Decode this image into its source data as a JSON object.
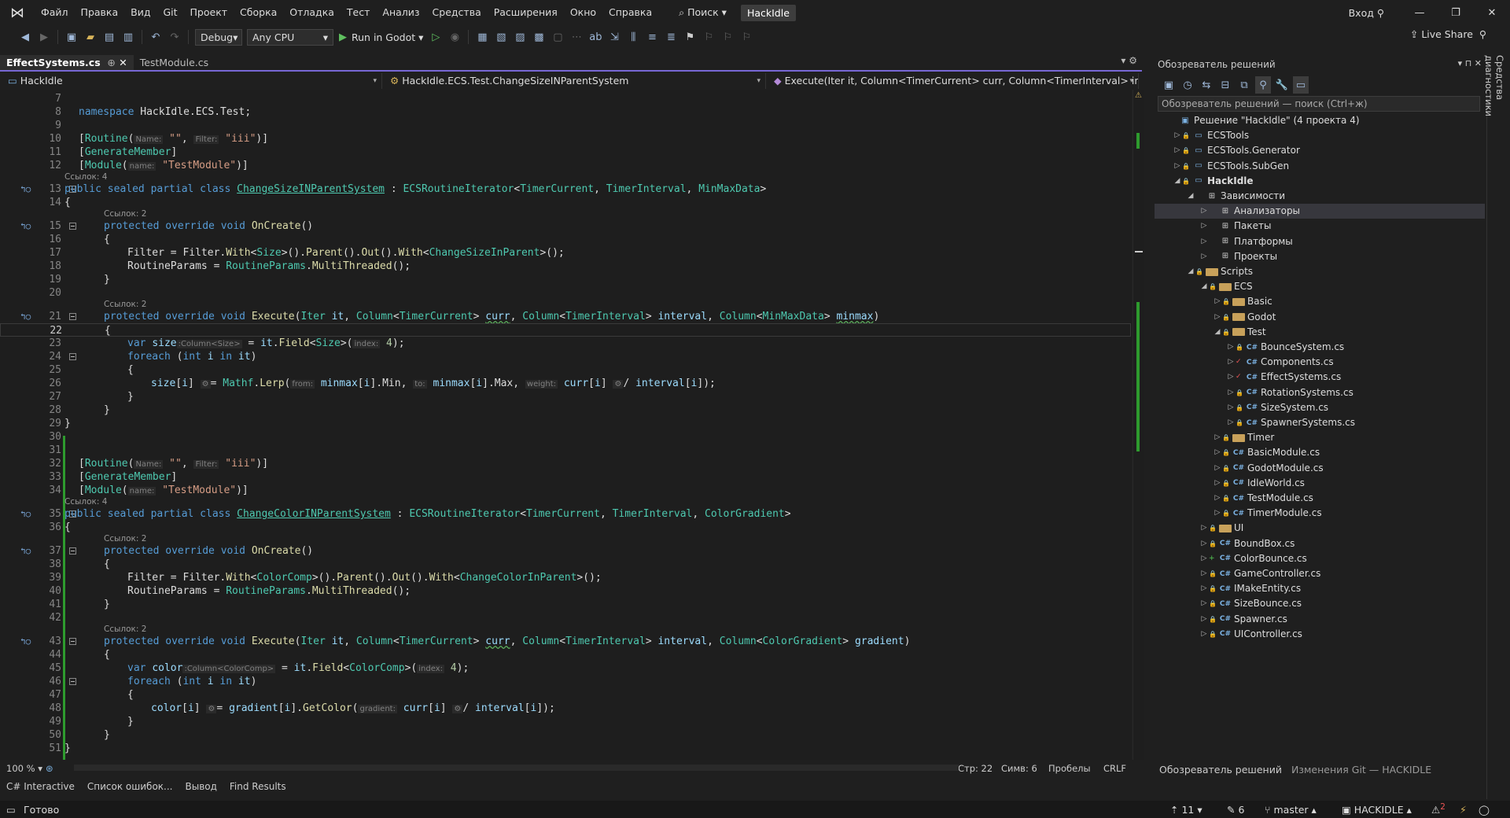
{
  "menu": [
    "Файл",
    "Правка",
    "Вид",
    "Git",
    "Проект",
    "Сборка",
    "Отладка",
    "Тест",
    "Анализ",
    "Средства",
    "Расширения",
    "Окно",
    "Справка"
  ],
  "search": "Поиск",
  "solution_title": "HackIdle",
  "signin": "Вход",
  "toolbar": {
    "config": "Debug",
    "platform": "Any CPU",
    "run": "Run in Godot",
    "liveshare": "Live Share"
  },
  "tabs": [
    {
      "label": "EffectSystems.cs",
      "active": true
    },
    {
      "label": "TestModule.cs",
      "active": false
    }
  ],
  "nav": {
    "project": "HackIdle",
    "type": "HackIdle.ECS.Test.ChangeSizeINParentSystem",
    "member": "Execute(Iter it, Column<TimerCurrent> curr, Column<TimerInterval> interval, Colu"
  },
  "lines": [
    {
      "n": "7",
      "html": ""
    },
    {
      "n": "8",
      "html": "<span class='k'>namespace</span> HackIdle.ECS.Test;"
    },
    {
      "n": "9",
      "html": ""
    },
    {
      "n": "10",
      "html": "[<span class='t'>Routine</span>(<span class='h'>Name:</span> <span class='s'>\"\"</span>, <span class='h'>Filter:</span> <span class='s'>\"iii\"</span>)]"
    },
    {
      "n": "11",
      "html": "[<span class='t'>GenerateMember</span>]"
    },
    {
      "n": "12",
      "html": "[<span class='t'>Module</span>(<span class='h'>name:</span> <span class='s'>\"TestModule\"</span>)]"
    },
    {
      "n": "13",
      "lens": "Ссылок: 4",
      "html": "<span class='k'>public sealed partial class</span> <span class='t u'>ChangeSizeINParentSystem</span> : <span class='t'>ECSRoutineIterator</span>&lt;<span class='t'>TimerCurrent</span>, <span class='t'>TimerInterval</span>, <span class='t'>MinMaxData</span>&gt;",
      "fold": true,
      "mark": true,
      "indent": -18
    },
    {
      "n": "14",
      "html": "{",
      "indent": -18
    },
    {
      "n": "15",
      "lens": "Ссылок: 2",
      "html": "<span class='k'>protected override void</span> <span class='m'>OnCreate</span>()",
      "fold": true,
      "mark": true,
      "indent": 8
    },
    {
      "n": "16",
      "html": "{",
      "indent": 8
    },
    {
      "n": "17",
      "html": "Filter = Filter.<span class='m'>With</span>&lt;<span class='t'>Size</span>&gt;().<span class='m'>Parent</span>().<span class='m'>Out</span>().<span class='m'>With</span>&lt;<span class='t'>ChangeSizeInParent</span>&gt;();",
      "indent": 38
    },
    {
      "n": "18",
      "html": "RoutineParams = <span class='t'>RoutineParams</span>.<span class='m'>MultiThreaded</span>();",
      "indent": 38
    },
    {
      "n": "19",
      "html": "}",
      "indent": 8
    },
    {
      "n": "20",
      "html": ""
    },
    {
      "n": "21",
      "lens": "Ссылок: 2",
      "html": "<span class='k'>protected override void</span> <span class='m'>Execute</span>(<span class='t'>Iter</span> <span class='v'>it</span>, <span class='t'>Column</span>&lt;<span class='t'>TimerCurrent</span>&gt; <span class='v w'>curr</span>, <span class='t'>Column</span>&lt;<span class='t'>TimerInterval</span>&gt; <span class='v'>interval</span>, <span class='t'>Column</span>&lt;<span class='t'>MinMaxData</span>&gt; <span class='v w'>minmax</span>)",
      "fold": true,
      "mark": true,
      "indent": 8
    },
    {
      "n": "22",
      "html": "{",
      "indent": 8,
      "cur": true
    },
    {
      "n": "23",
      "html": "<span class='k'>var</span> <span class='v'>size</span><span class='h'>:Column&lt;Size&gt;</span> = <span class='v'>it</span>.<span class='m'>Field</span>&lt;<span class='t'>Size</span>&gt;(<span class='h'>index:</span> <span class='n'>4</span>);",
      "indent": 38
    },
    {
      "n": "24",
      "html": "<span class='k'>foreach</span> (<span class='k'>int</span> <span class='v'>i</span> <span class='k'>in</span> <span class='v'>it</span>)",
      "fold": true,
      "indent": 38
    },
    {
      "n": "25",
      "html": "{",
      "indent": 38
    },
    {
      "n": "26",
      "html": "<span class='v'>size</span>[<span class='v'>i</span>] <span class='h'>⚙</span>= <span class='t'>Mathf</span>.<span class='m'>Lerp</span>(<span class='h'>from:</span> <span class='v'>minmax</span>[<span class='v'>i</span>].Min, <span class='h'>to:</span> <span class='v'>minmax</span>[<span class='v'>i</span>].Max, <span class='h'>weight:</span> <span class='v'>curr</span>[<span class='v'>i</span>] <span class='h'>⚙</span>/ <span class='v'>interval</span>[<span class='v'>i</span>]);",
      "indent": 68
    },
    {
      "n": "27",
      "html": "}",
      "indent": 38
    },
    {
      "n": "28",
      "html": "}",
      "indent": 8
    },
    {
      "n": "29",
      "html": "}",
      "indent": -18
    },
    {
      "n": "30",
      "html": ""
    },
    {
      "n": "31",
      "html": ""
    },
    {
      "n": "32",
      "html": "[<span class='t'>Routine</span>(<span class='h'>Name:</span> <span class='s'>\"\"</span>, <span class='h'>Filter:</span> <span class='s'>\"iii\"</span>)]"
    },
    {
      "n": "33",
      "html": "[<span class='t'>GenerateMember</span>]"
    },
    {
      "n": "34",
      "html": "[<span class='t'>Module</span>(<span class='h'>name:</span> <span class='s'>\"TestModule\"</span>)]"
    },
    {
      "n": "35",
      "lens": "Ссылок: 4",
      "html": "<span class='k'>public sealed partial class</span> <span class='t u'>ChangeColorINParentSystem</span> : <span class='t'>ECSRoutineIterator</span>&lt;<span class='t'>TimerCurrent</span>, <span class='t'>TimerInterval</span>, <span class='t'>ColorGradient</span>&gt;",
      "fold": true,
      "mark": true,
      "indent": -18
    },
    {
      "n": "36",
      "html": "{",
      "indent": -18
    },
    {
      "n": "37",
      "lens": "Ссылок: 2",
      "html": "<span class='k'>protected override void</span> <span class='m'>OnCreate</span>()",
      "fold": true,
      "mark": true,
      "indent": 8
    },
    {
      "n": "38",
      "html": "{",
      "indent": 8
    },
    {
      "n": "39",
      "html": "Filter = Filter.<span class='m'>With</span>&lt;<span class='t'>ColorComp</span>&gt;().<span class='m'>Parent</span>().<span class='m'>Out</span>().<span class='m'>With</span>&lt;<span class='t'>ChangeColorInParent</span>&gt;();",
      "indent": 38
    },
    {
      "n": "40",
      "html": "RoutineParams = <span class='t'>RoutineParams</span>.<span class='m'>MultiThreaded</span>();",
      "indent": 38
    },
    {
      "n": "41",
      "html": "}",
      "indent": 8
    },
    {
      "n": "42",
      "html": ""
    },
    {
      "n": "43",
      "lens": "Ссылок: 2",
      "html": "<span class='k'>protected override void</span> <span class='m'>Execute</span>(<span class='t'>Iter</span> <span class='v'>it</span>, <span class='t'>Column</span>&lt;<span class='t'>TimerCurrent</span>&gt; <span class='v w'>curr</span>, <span class='t'>Column</span>&lt;<span class='t'>TimerInterval</span>&gt; <span class='v'>interval</span>, <span class='t'>Column</span>&lt;<span class='t'>ColorGradient</span>&gt; <span class='v'>gradient</span>)",
      "fold": true,
      "mark": true,
      "indent": 8
    },
    {
      "n": "44",
      "html": "{",
      "indent": 8
    },
    {
      "n": "45",
      "html": "<span class='k'>var</span> <span class='v'>color</span><span class='h'>:Column&lt;ColorComp&gt;</span> = <span class='v'>it</span>.<span class='m'>Field</span>&lt;<span class='t'>ColorComp</span>&gt;(<span class='h'>index:</span> <span class='n'>4</span>);",
      "indent": 38
    },
    {
      "n": "46",
      "html": "<span class='k'>foreach</span> (<span class='k'>int</span> <span class='v'>i</span> <span class='k'>in</span> <span class='v'>it</span>)",
      "fold": true,
      "indent": 38
    },
    {
      "n": "47",
      "html": "{",
      "indent": 38
    },
    {
      "n": "48",
      "html": "<span class='v'>color</span>[<span class='v'>i</span>] <span class='h'>⚙</span>= <span class='v'>gradient</span>[<span class='v'>i</span>].<span class='m'>GetColor</span>(<span class='h'>gradient:</span> <span class='v'>curr</span>[<span class='v'>i</span>] <span class='h'>⚙</span>/ <span class='v'>interval</span>[<span class='v'>i</span>]);",
      "indent": 68
    },
    {
      "n": "49",
      "html": "}",
      "indent": 38
    },
    {
      "n": "50",
      "html": "}",
      "indent": 8
    },
    {
      "n": "51",
      "html": "}",
      "indent": -18
    }
  ],
  "editor_status": {
    "zoom": "100 %",
    "line": "Стр: 22",
    "col": "Симв: 6",
    "spaces": "Пробелы",
    "eol": "CRLF"
  },
  "bottom_tabs": [
    "C# Interactive",
    "Список ошибок...",
    "Вывод",
    "Find Results"
  ],
  "status": {
    "ready": "Готово",
    "up": "11",
    "pencil": "6",
    "branch": "master",
    "repo": "HACKIDLE",
    "errors": "2"
  },
  "solution_explorer": {
    "title": "Обозреватель решений",
    "search_placeholder": "Обозреватель решений — поиск (Ctrl+ж)",
    "vertical_tab": "Средства диагностики",
    "footer": [
      "Обозреватель решений",
      "Изменения Git — HACKIDLE"
    ],
    "items": [
      {
        "label": "Решение \"HackIdle\"  (4 проекта 4)",
        "level": 0,
        "arrow": "",
        "icon": "solution"
      },
      {
        "label": "ECSTools",
        "level": 1,
        "arrow": "▷",
        "icon": "project"
      },
      {
        "label": "ECSTools.Generator",
        "level": 1,
        "arrow": "▷",
        "icon": "project"
      },
      {
        "label": "ECSTools.SubGen",
        "level": 1,
        "arrow": "▷",
        "icon": "project"
      },
      {
        "label": "HackIdle",
        "level": 1,
        "arrow": "◢",
        "icon": "project",
        "bold": true
      },
      {
        "label": "Зависимости",
        "level": 2,
        "arrow": "◢",
        "icon": "deps"
      },
      {
        "label": "Анализаторы",
        "level": 3,
        "arrow": "▷",
        "icon": "analyzer",
        "selected": true
      },
      {
        "label": "Пакеты",
        "level": 3,
        "arrow": "▷",
        "icon": "packages"
      },
      {
        "label": "Платформы",
        "level": 3,
        "arrow": "▷",
        "icon": "platform"
      },
      {
        "label": "Проекты",
        "level": 3,
        "arrow": "▷",
        "icon": "projects"
      },
      {
        "label": "Scripts",
        "level": 2,
        "arrow": "◢",
        "icon": "folder"
      },
      {
        "label": "ECS",
        "level": 3,
        "arrow": "◢",
        "icon": "folder"
      },
      {
        "label": "Basic",
        "level": 4,
        "arrow": "▷",
        "icon": "folder"
      },
      {
        "label": "Godot",
        "level": 4,
        "arrow": "▷",
        "icon": "folder"
      },
      {
        "label": "Test",
        "level": 4,
        "arrow": "◢",
        "icon": "folder"
      },
      {
        "label": "BounceSystem.cs",
        "level": 5,
        "arrow": "▷",
        "icon": "cs"
      },
      {
        "label": "Components.cs",
        "level": 5,
        "arrow": "▷",
        "icon": "cs",
        "check": true
      },
      {
        "label": "EffectSystems.cs",
        "level": 5,
        "arrow": "▷",
        "icon": "cs",
        "check": true
      },
      {
        "label": "RotationSystems.cs",
        "level": 5,
        "arrow": "▷",
        "icon": "cs"
      },
      {
        "label": "SizeSystem.cs",
        "level": 5,
        "arrow": "▷",
        "icon": "cs"
      },
      {
        "label": "SpawnerSystems.cs",
        "level": 5,
        "arrow": "▷",
        "icon": "cs"
      },
      {
        "label": "Timer",
        "level": 4,
        "arrow": "▷",
        "icon": "folder"
      },
      {
        "label": "BasicModule.cs",
        "level": 4,
        "arrow": "▷",
        "icon": "cs"
      },
      {
        "label": "GodotModule.cs",
        "level": 4,
        "arrow": "▷",
        "icon": "cs"
      },
      {
        "label": "IdleWorld.cs",
        "level": 4,
        "arrow": "▷",
        "icon": "cs"
      },
      {
        "label": "TestModule.cs",
        "level": 4,
        "arrow": "▷",
        "icon": "cs"
      },
      {
        "label": "TimerModule.cs",
        "level": 4,
        "arrow": "▷",
        "icon": "cs"
      },
      {
        "label": "UI",
        "level": 3,
        "arrow": "▷",
        "icon": "folder"
      },
      {
        "label": "BoundBox.cs",
        "level": 3,
        "arrow": "▷",
        "icon": "cs"
      },
      {
        "label": "ColorBounce.cs",
        "level": 3,
        "arrow": "▷",
        "icon": "cs",
        "plus": true
      },
      {
        "label": "GameController.cs",
        "level": 3,
        "arrow": "▷",
        "icon": "cs"
      },
      {
        "label": "IMakeEntity.cs",
        "level": 3,
        "arrow": "▷",
        "icon": "cs"
      },
      {
        "label": "SizeBounce.cs",
        "level": 3,
        "arrow": "▷",
        "icon": "cs"
      },
      {
        "label": "Spawner.cs",
        "level": 3,
        "arrow": "▷",
        "icon": "cs"
      },
      {
        "label": "UIController.cs",
        "level": 3,
        "arrow": "▷",
        "icon": "cs"
      }
    ]
  }
}
